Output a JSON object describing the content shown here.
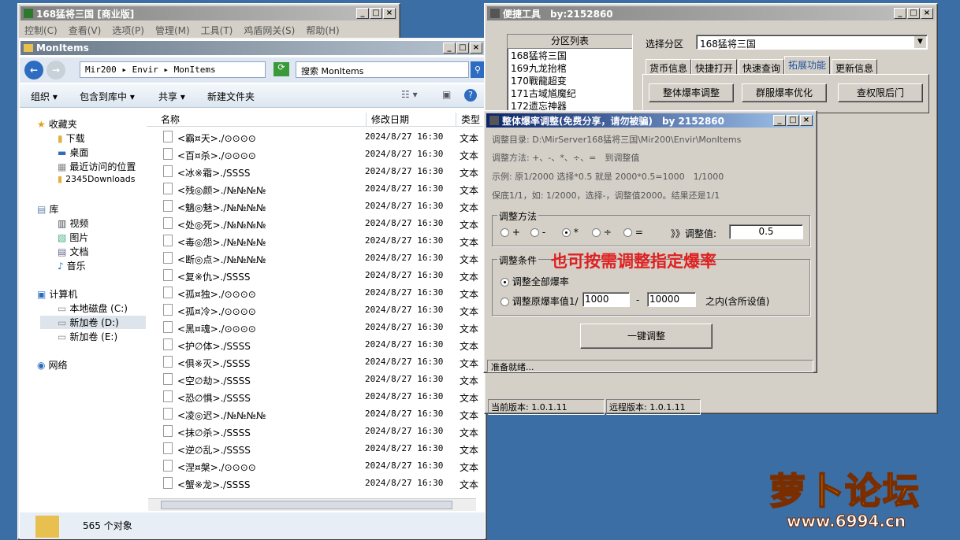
{
  "main_window": {
    "title": "168猛将三国 [商业版]",
    "menu": [
      "控制(C)",
      "查看(V)",
      "选项(P)",
      "管理(M)",
      "工具(T)",
      "鸡盾网关(S)",
      "帮助(H)"
    ]
  },
  "explorer": {
    "title": "MonItems",
    "path": [
      "Mir200",
      "Envir",
      "MonItems"
    ],
    "search_placeholder": "搜索 MonItems",
    "toolbar": [
      "组织",
      "包含到库中",
      "共享",
      "新建文件夹"
    ],
    "nav": {
      "favorites_header": "收藏夹",
      "favorites": [
        "下载",
        "桌面",
        "最近访问的位置",
        "2345Downloads"
      ],
      "library_header": "库",
      "library": [
        "视频",
        "图片",
        "文档",
        "音乐"
      ],
      "computer_header": "计算机",
      "computer": [
        "本地磁盘 (C:)",
        "新加卷 (D:)",
        "新加卷 (E:)"
      ],
      "network": "网络"
    },
    "columns": [
      "名称",
      "修改日期",
      "类型"
    ],
    "files": [
      {
        "name": "<霸¤天>./⊙⊙⊙⊙",
        "date": "2024/8/27 16:30",
        "type": "文本"
      },
      {
        "name": "<百¤杀>./⊙⊙⊙⊙",
        "date": "2024/8/27 16:30",
        "type": "文本"
      },
      {
        "name": "<冰※霜>./SSSS",
        "date": "2024/8/27 16:30",
        "type": "文本"
      },
      {
        "name": "<残◎颜>./№№№№",
        "date": "2024/8/27 16:30",
        "type": "文本"
      },
      {
        "name": "<魑◎魅>./№№№№",
        "date": "2024/8/27 16:30",
        "type": "文本"
      },
      {
        "name": "<处◎死>./№№№№",
        "date": "2024/8/27 16:30",
        "type": "文本"
      },
      {
        "name": "<毒◎怨>./№№№№",
        "date": "2024/8/27 16:30",
        "type": "文本"
      },
      {
        "name": "<断◎点>./№№№№",
        "date": "2024/8/27 16:30",
        "type": "文本"
      },
      {
        "name": "<复※仇>./SSSS",
        "date": "2024/8/27 16:30",
        "type": "文本"
      },
      {
        "name": "<孤¤独>./⊙⊙⊙⊙",
        "date": "2024/8/27 16:30",
        "type": "文本"
      },
      {
        "name": "<孤¤冷>./⊙⊙⊙⊙",
        "date": "2024/8/27 16:30",
        "type": "文本"
      },
      {
        "name": "<黑¤魂>./⊙⊙⊙⊙",
        "date": "2024/8/27 16:30",
        "type": "文本"
      },
      {
        "name": "<护∅体>./SSSS",
        "date": "2024/8/27 16:30",
        "type": "文本"
      },
      {
        "name": "<俱※灭>./SSSS",
        "date": "2024/8/27 16:30",
        "type": "文本"
      },
      {
        "name": "<空∅劫>./SSSS",
        "date": "2024/8/27 16:30",
        "type": "文本"
      },
      {
        "name": "<恐∅惧>./SSSS",
        "date": "2024/8/27 16:30",
        "type": "文本"
      },
      {
        "name": "<凌◎迟>./№№№№",
        "date": "2024/8/27 16:30",
        "type": "文本"
      },
      {
        "name": "<抹∅杀>./SSSS",
        "date": "2024/8/27 16:30",
        "type": "文本"
      },
      {
        "name": "<逆∅乱>./SSSS",
        "date": "2024/8/27 16:30",
        "type": "文本"
      },
      {
        "name": "<涅¤槃>./⊙⊙⊙⊙",
        "date": "2024/8/27 16:30",
        "type": "文本"
      },
      {
        "name": "<蟹※龙>./SSSS",
        "date": "2024/8/27 16:30",
        "type": "文本"
      }
    ],
    "status": "565 个对象"
  },
  "tool": {
    "title": "便捷工具　by:2152860",
    "list_header": "分区列表",
    "list": [
      "168猛将三国",
      "169九龙抬棺",
      "170戰龍超变",
      "171古域馗魔纪",
      "172遗忘神器"
    ],
    "select_label": "选择分区",
    "select_value": "168猛将三国",
    "tabs": [
      "货币信息",
      "快捷打开",
      "快速查询",
      "拓展功能",
      "更新信息"
    ],
    "buttons": [
      "整体爆率调整",
      "群服爆率优化",
      "查权限后门"
    ],
    "current_version": "当前版本: 1.0.1.11",
    "remote_version": "远程版本: 1.0.1.11"
  },
  "dialog": {
    "title": "整体爆率调整(免费分享，请勿被骗)　by 2152860",
    "dir": "调整目录: D:\\MirServer168猛将三国\\Mir200\\Envir\\MonItems",
    "method_desc": "调整方法: +、-、*、÷、=　到调整值",
    "example": "示例: 原1/2000 选择*0.5 就是 2000*0.5=1000　1/1000",
    "note": "保底1/1，如: 1/2000，选择-，调整值2000。结果还是1/1",
    "method_group": "调整方法",
    "ops": [
      "+",
      "-",
      "*",
      "÷",
      "="
    ],
    "value_label": "》》调整值:",
    "value": "0.5",
    "cond_group": "调整条件",
    "cond_all": "调整全部爆率",
    "cond_range": "调整原爆率值1/",
    "range_from": "1000",
    "range_dash": "-",
    "range_to": "10000",
    "range_suffix": "之内(含所设值)",
    "annotation": "也可按需调整指定爆率",
    "apply": "一键调整",
    "status": "准备就绪..."
  },
  "watermark": {
    "text": "萝卜论坛",
    "url": "www.6994.cn"
  }
}
